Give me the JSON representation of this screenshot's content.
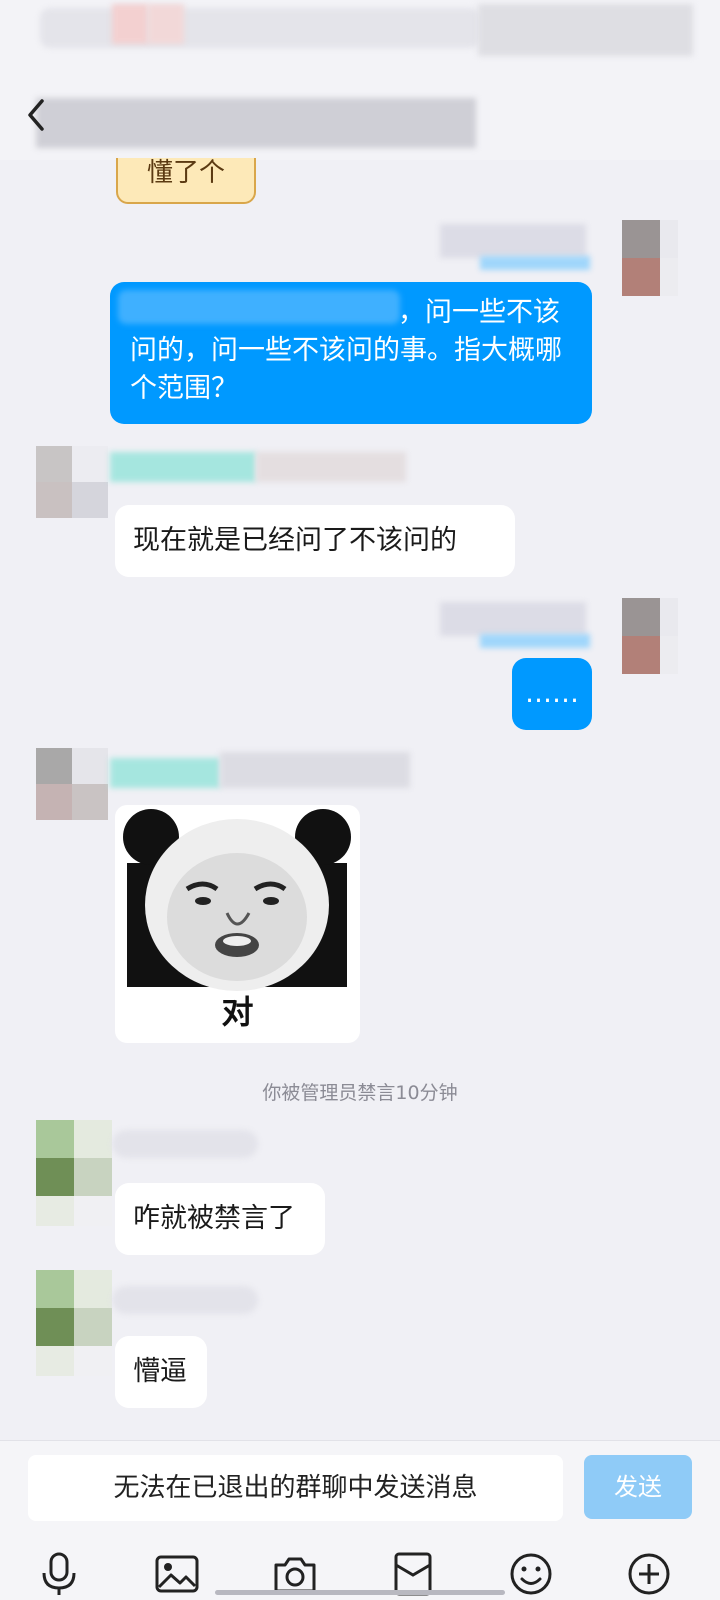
{
  "header": {
    "back": "back",
    "title": "",
    "icons": [
      "chevron-left-icon"
    ]
  },
  "sticker_peek": {
    "text": "懂了个"
  },
  "messages": [
    {
      "side": "out",
      "text_visible": "，问一些不该问的，问一些不该问的事。指大概哪个范围？"
    },
    {
      "side": "in",
      "text": "现在就是已经问了不该问的"
    },
    {
      "side": "out",
      "text": "……"
    },
    {
      "side": "in",
      "type": "sticker",
      "caption": "对"
    },
    {
      "side": "in",
      "text": "咋就被禁言了"
    },
    {
      "side": "in",
      "text": "懵逼"
    }
  ],
  "system": {
    "muted_note": "你被管理员禁言10分钟"
  },
  "composer": {
    "placeholder": "无法在已退出的群聊中发送消息",
    "send_label": "发送"
  },
  "toolbar": {
    "icons": [
      "microphone-icon",
      "image-icon",
      "camera-icon",
      "red-packet-icon",
      "emoji-icon",
      "plus-icon"
    ]
  },
  "colors": {
    "outgoing_bubble": "#0099ff",
    "incoming_bubble": "#ffffff",
    "background": "#f0f0f5",
    "send_disabled": "#8fcbf7"
  }
}
